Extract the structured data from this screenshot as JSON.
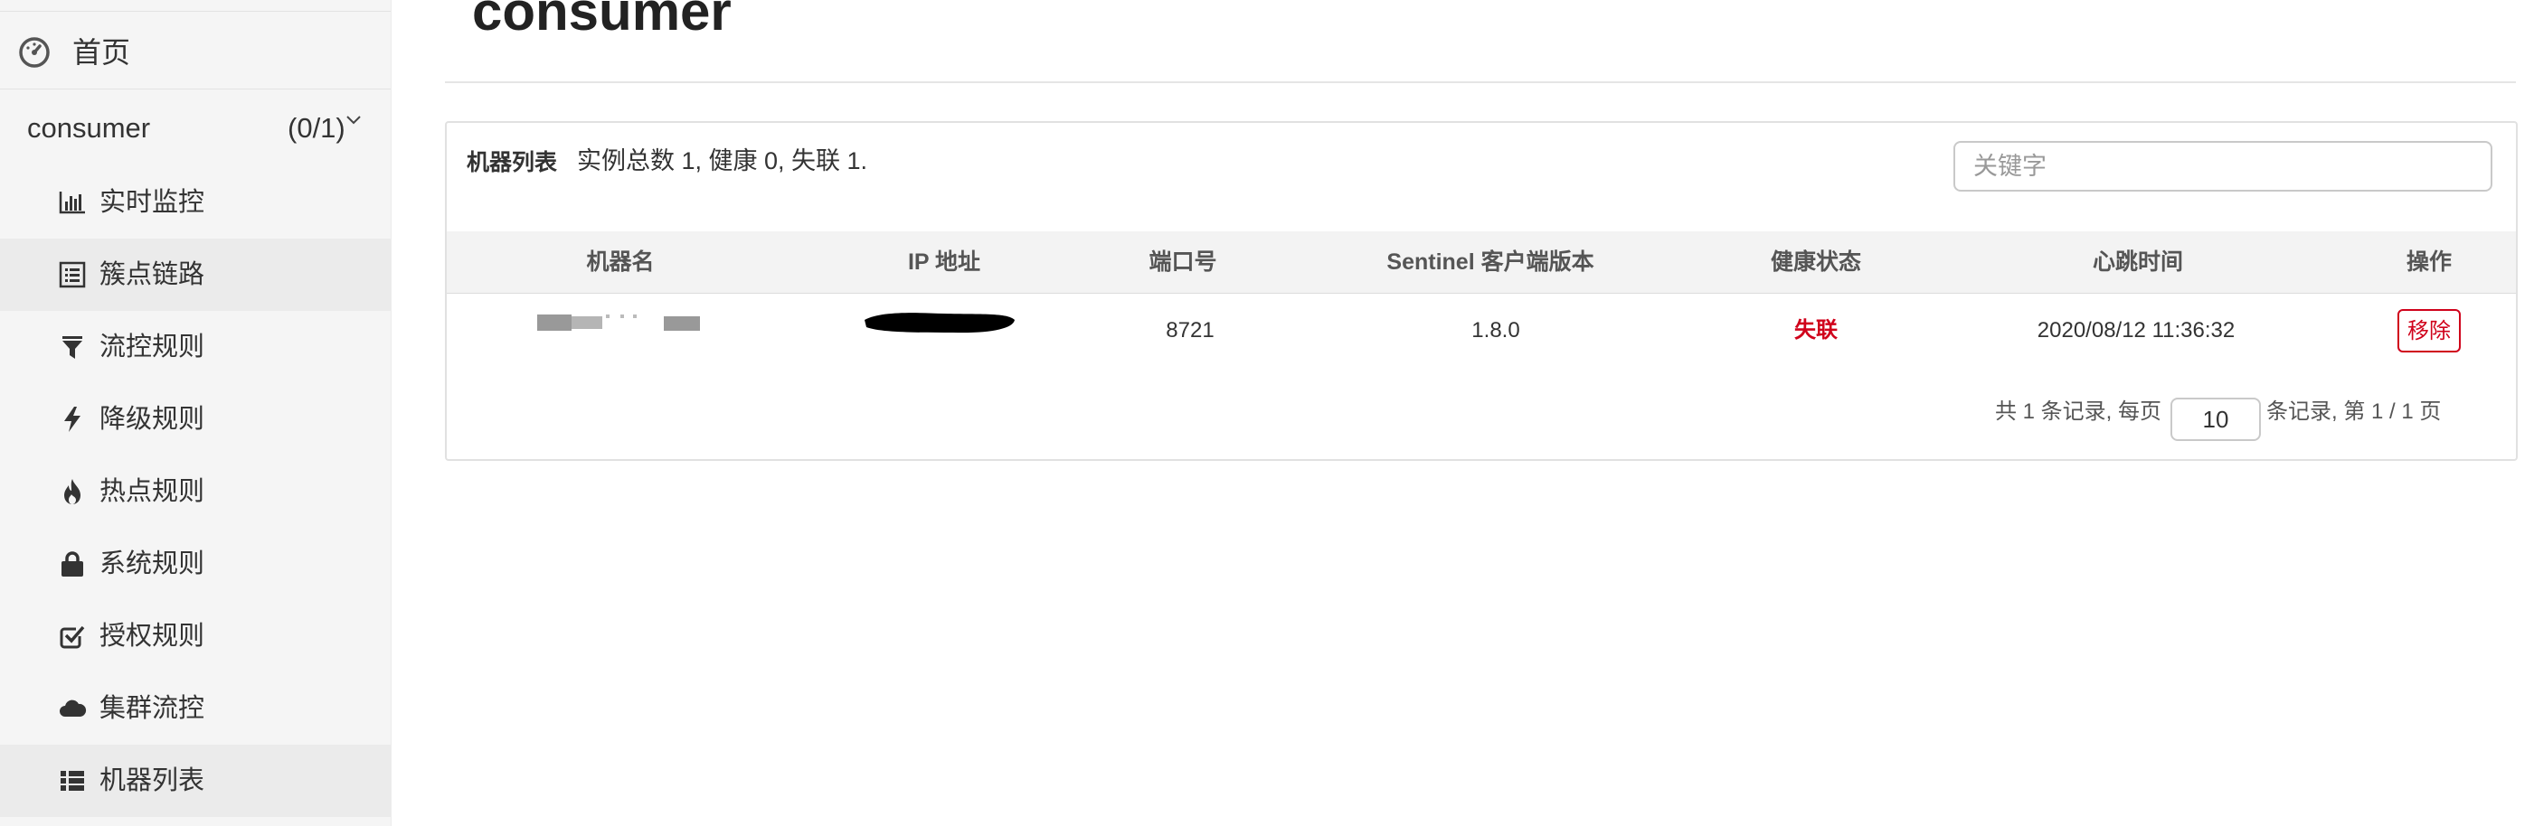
{
  "sidebar": {
    "home": {
      "label": "首页",
      "icon": "dashboard-icon"
    },
    "app": {
      "name": "consumer",
      "count": "(0/1)"
    },
    "items": [
      {
        "label": "实时监控",
        "icon": "bar-chart-icon"
      },
      {
        "label": "簇点链路",
        "icon": "list-alt-icon"
      },
      {
        "label": "流控规则",
        "icon": "filter-icon"
      },
      {
        "label": "降级规则",
        "icon": "flash-icon"
      },
      {
        "label": "热点规则",
        "icon": "fire-icon"
      },
      {
        "label": "系统规则",
        "icon": "lock-icon"
      },
      {
        "label": "授权规则",
        "icon": "check-icon"
      },
      {
        "label": "集群流控",
        "icon": "cloud-icon"
      },
      {
        "label": "机器列表",
        "icon": "th-list-icon"
      }
    ]
  },
  "page": {
    "title": "consumer"
  },
  "panel": {
    "title": "机器列表",
    "summary": "实例总数 1, 健康 0, 失联 1.",
    "search_placeholder": "关键字"
  },
  "table": {
    "headers": [
      "机器名",
      "IP 地址",
      "端口号",
      "Sentinel 客户端版本",
      "健康状态",
      "心跳时间",
      "操作"
    ],
    "rows": [
      {
        "port": "8721",
        "version": "1.8.0",
        "status": "失联",
        "heartbeat": "2020/08/12 11:36:32",
        "action": "移除"
      }
    ]
  },
  "pager": {
    "prefix": "共 1 条记录, 每页",
    "page_size": "10",
    "suffix": "条记录, 第 1 / 1 页"
  },
  "colors": {
    "danger": "#d0021b",
    "sidebar_bg": "#f5f5f5",
    "active_bg": "#ebebeb"
  }
}
